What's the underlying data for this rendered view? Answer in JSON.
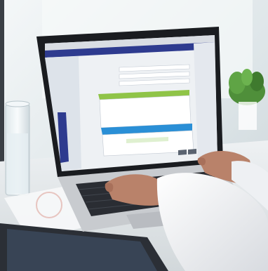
{
  "scene": {
    "subject": "laptop-on-desk-with-hands-typing",
    "colors": {
      "background": "#e9eef0",
      "window": "#dfe7ea",
      "laptop_body": "#c8cbcf",
      "laptop_bezel": "#1a1c20",
      "keyboard": "#2a2d33",
      "screen_header": "#2e3b8f",
      "accent_green": "#8fc447",
      "accent_blue": "#2a8fd6",
      "sleeve": "#f3f4f6",
      "skin": "#b9826a",
      "plant": "#4f8f3a"
    }
  }
}
